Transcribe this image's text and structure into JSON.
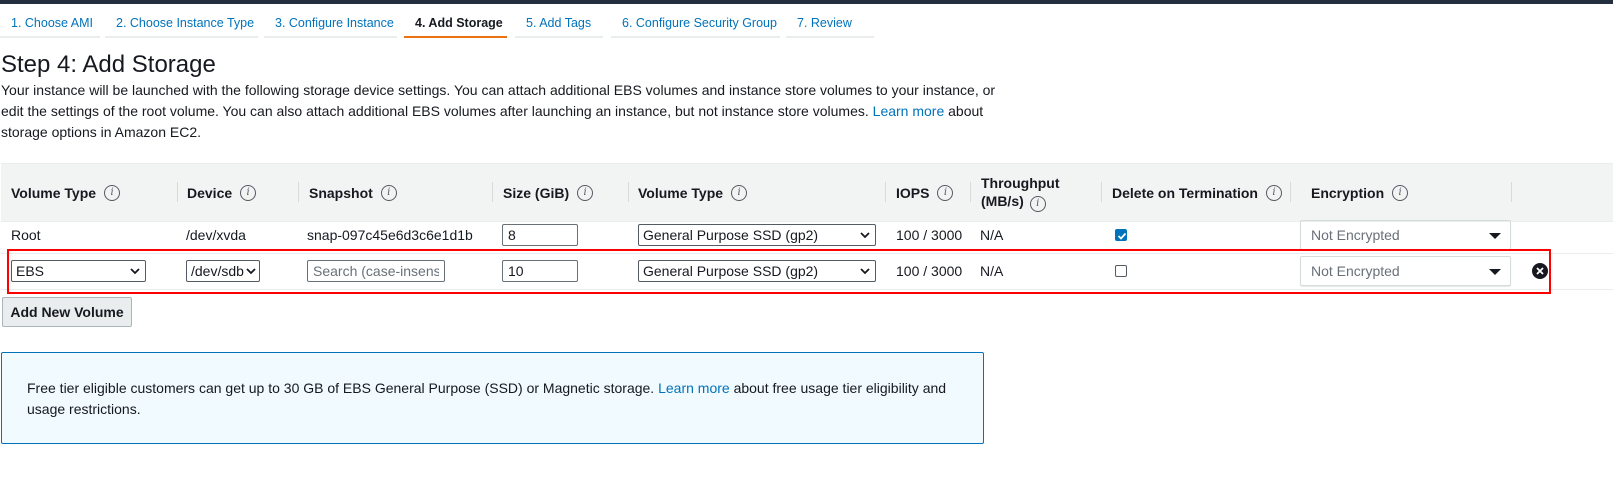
{
  "wizard": {
    "tabs": [
      {
        "label": "1. Choose AMI"
      },
      {
        "label": "2. Choose Instance Type"
      },
      {
        "label": "3. Configure Instance"
      },
      {
        "label": "4. Add Storage"
      },
      {
        "label": "5. Add Tags"
      },
      {
        "label": "6. Configure Security Group"
      },
      {
        "label": "7. Review"
      }
    ],
    "active_tab": "4. Add Storage"
  },
  "page": {
    "title": "Step 4: Add Storage",
    "description_part1": "Your instance will be launched with the following storage device settings. You can attach additional EBS volumes and instance store volumes to your instance, or edit the settings of the root volume. You can also attach additional EBS volumes after launching an instance, but not instance store volumes.",
    "learn_more": "Learn more",
    "description_part2": "about storage options in Amazon EC2."
  },
  "table": {
    "headers": {
      "volume_type": "Volume Type",
      "device": "Device",
      "snapshot": "Snapshot",
      "size": "Size (GiB)",
      "volume_type2": "Volume Type",
      "iops": "IOPS",
      "throughput_line1": "Throughput",
      "throughput_line2": "(MB/s)",
      "delete_on_termination": "Delete on Termination",
      "encryption": "Encryption"
    },
    "info_icon": "i",
    "rows": [
      {
        "volume_type": "Root",
        "device": "/dev/xvda",
        "snapshot": "snap-097c45e6d3c6e1d1b",
        "size": "8",
        "ebs_volume_type": "General Purpose SSD (gp2)",
        "iops": "100 / 3000",
        "throughput": "N/A",
        "delete_on_termination": true,
        "encryption": "Not Encrypted"
      },
      {
        "volume_type": "EBS",
        "device": "/dev/sdb",
        "snapshot_placeholder": "Search (case-insensitive)",
        "size": "10",
        "ebs_volume_type": "General Purpose SSD (gp2)",
        "iops": "100 / 3000",
        "throughput": "N/A",
        "delete_on_termination": false,
        "encryption": "Not Encrypted"
      }
    ]
  },
  "actions": {
    "add_new_volume": "Add New Volume"
  },
  "free_tier": {
    "message_part1": "Free tier eligible customers can get up to 30 GB of EBS General Purpose (SSD) or Magnetic storage.",
    "learn_more": "Learn more",
    "message_part2": "about free usage tier eligibility and usage restrictions."
  },
  "colors": {
    "link": "#0073bb",
    "active_tab_underline": "#ec7211",
    "highlight": "#ff0000",
    "info_box_bg": "#f1faff"
  }
}
